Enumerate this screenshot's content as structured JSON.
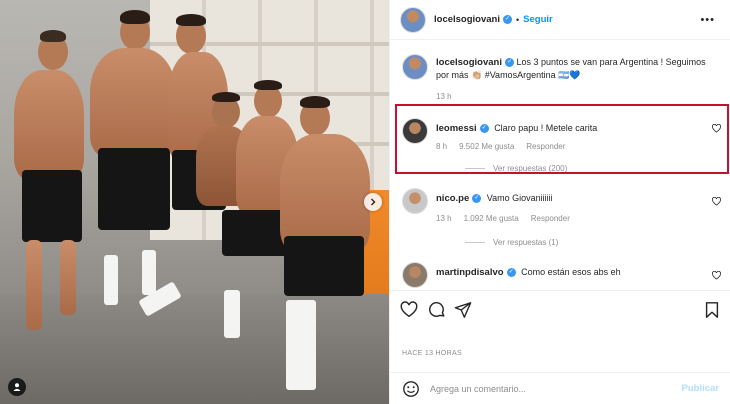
{
  "header": {
    "username": "locelsogiovani",
    "follow_label": "Seguir",
    "more_label": "•••"
  },
  "caption": {
    "username": "locelsogiovani",
    "text": "Los 3 puntos se van para Argentina ! Seguimos por más 👏🏼 #VamosArgentina 🇦🇷💙",
    "time": "13 h"
  },
  "comments": [
    {
      "username": "leomessi",
      "text": "Claro papu ! Metele carita",
      "time": "8 h",
      "likes": "9.502 Me gusta",
      "reply_label": "Responder",
      "replies_label": "Ver respuestas (200)"
    },
    {
      "username": "nico.pe",
      "text": "Vamo Giovaniiiiii",
      "time": "13 h",
      "likes": "1.092 Me gusta",
      "reply_label": "Responder",
      "replies_label": "Ver respuestas (1)"
    },
    {
      "username": "martinpdisalvo",
      "text": "Como están esos abs eh"
    }
  ],
  "footer": {
    "timestamp": "HACE 13 HORAS",
    "comment_placeholder": "Agrega un comentario...",
    "publish_label": "Publicar"
  },
  "colors": {
    "accent": "#0095f6",
    "highlight_border": "#c8102e",
    "verified": "#3897f0"
  }
}
